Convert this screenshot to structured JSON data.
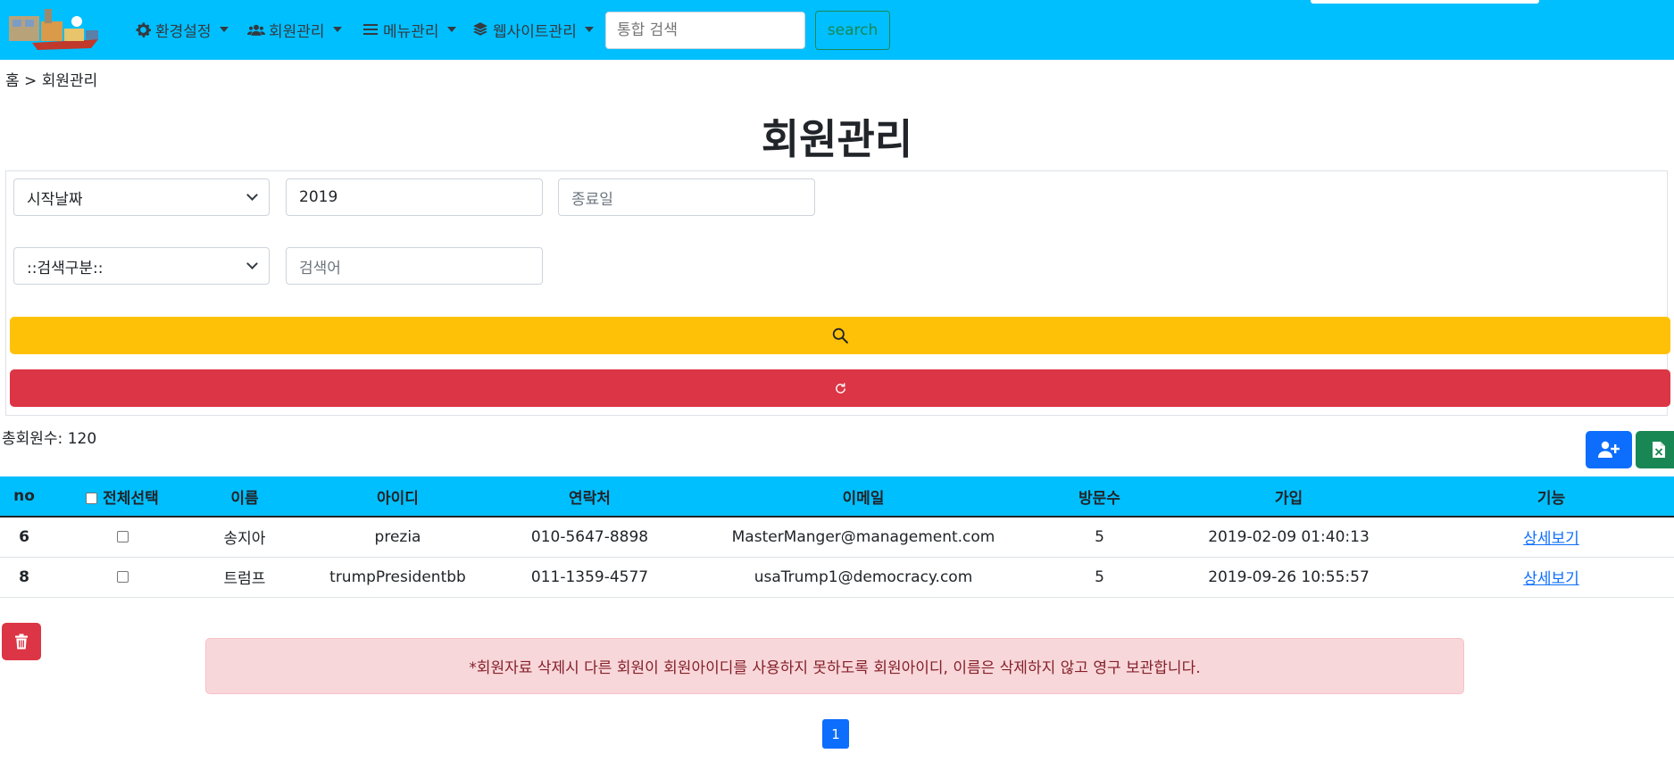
{
  "navbar": {
    "menus": [
      {
        "label": "환경설정",
        "icon": "gear-icon"
      },
      {
        "label": "회원관리",
        "icon": "users-icon"
      },
      {
        "label": "메뉴관리",
        "icon": "list-icon"
      },
      {
        "label": "웹사이트관리",
        "icon": "layers-icon"
      }
    ],
    "search_placeholder": "통합 검색",
    "search_button": "search",
    "bg_color": "#00bfff"
  },
  "breadcrumb": "홈 > 회원관리",
  "page_title": "회원관리",
  "filters": {
    "date_type_selected": "시작날짜",
    "start_value": "2019",
    "end_placeholder": "종료일",
    "search_type_selected": "::검색구분::",
    "keyword_placeholder": "검색어"
  },
  "summary": {
    "total_members": "총회원수: 120"
  },
  "table": {
    "headers": [
      "no",
      "전체선택",
      "이름",
      "아이디",
      "연락처",
      "이메일",
      "방문수",
      "가입",
      "기능"
    ],
    "rows": [
      {
        "no": "6",
        "name": "송지아",
        "id": "prezia",
        "phone": "010-5647-8898",
        "email": "MasterManger@management.com",
        "visits": "5",
        "joined": "2019-02-09 01:40:13",
        "action": "상세보기"
      },
      {
        "no": "8",
        "name": "트럼프",
        "id": "trumpPresidentbb",
        "phone": "011-1359-4577",
        "email": "usaTrump1@democracy.com",
        "visits": "5",
        "joined": "2019-09-26 10:55:57",
        "action": "상세보기"
      }
    ]
  },
  "notice": "*회원자료 삭제시 다른 회원이 회원아이디를 사용하지 못하도록 회원아이디, 이름은 삭제하지 않고 영구 보관합니다.",
  "pagination": {
    "current_page": "1"
  },
  "colors": {
    "search_button": "#ffc107",
    "reset_button": "#dc3545",
    "add_user_button": "#0d6efd",
    "excel_button": "#198754",
    "delete_button": "#dc3545"
  }
}
